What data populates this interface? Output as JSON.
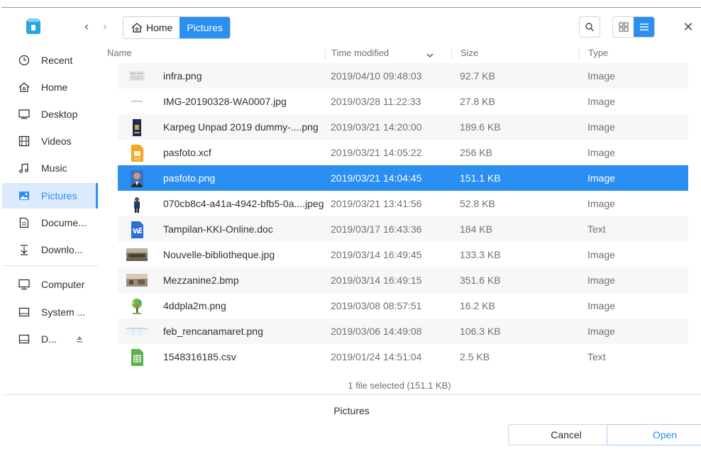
{
  "header": {
    "breadcrumb": [
      {
        "label": "Home",
        "icon": "home-icon"
      },
      {
        "label": "Pictures"
      }
    ],
    "back_icon": "chevron-left-icon",
    "forward_icon": "chevron-right-icon",
    "search_icon": "search-icon",
    "icon_view_icon": "grid-view-icon",
    "list_view_icon": "list-view-icon",
    "close_icon": "close-icon"
  },
  "sidebar": {
    "items": [
      {
        "label": "Recent",
        "icon": "clock-icon"
      },
      {
        "label": "Home",
        "icon": "home-icon"
      },
      {
        "label": "Desktop",
        "icon": "desktop-icon"
      },
      {
        "label": "Videos",
        "icon": "film-icon"
      },
      {
        "label": "Music",
        "icon": "music-icon"
      },
      {
        "label": "Pictures",
        "icon": "image-icon",
        "active": true
      },
      {
        "label": "Docume...",
        "icon": "document-icon"
      },
      {
        "label": "Downlo...",
        "icon": "download-icon"
      },
      {
        "label": "Computer",
        "icon": "computer-icon"
      },
      {
        "label": "System ...",
        "icon": "drive-icon"
      },
      {
        "label": "D...",
        "icon": "drive-icon",
        "eject_icon": "eject-icon"
      }
    ]
  },
  "list": {
    "columns": {
      "name": "Name",
      "time": "Time modified",
      "size": "Size",
      "type": "Type",
      "sort_icon": "chevron-down-icon"
    },
    "rows": [
      {
        "name": "infra.png",
        "time": "2019/04/10 09:48:03",
        "size": "92.7 KB",
        "type": "Image",
        "thumb": "image-thumbnail"
      },
      {
        "name": "IMG-20190328-WA0007.jpg",
        "time": "2019/03/28 11:22:33",
        "size": "27.8 KB",
        "type": "Image",
        "thumb": "signature-thumbnail"
      },
      {
        "name": "Karpeg Unpad 2019 dummy-....png",
        "time": "2019/03/21 14:20:00",
        "size": "189.6 KB",
        "type": "Image",
        "thumb": "card-thumbnail"
      },
      {
        "name": "pasfoto.xcf",
        "time": "2019/03/21 14:05:22",
        "size": "256 KB",
        "type": "Image",
        "thumb": "xcf-file-icon"
      },
      {
        "name": "pasfoto.png",
        "time": "2019/03/21 14:04:45",
        "size": "151.1 KB",
        "type": "Image",
        "thumb": "portrait-thumbnail",
        "selected": true
      },
      {
        "name": "070cb8c4-a41a-4942-bfb5-0a....jpeg",
        "time": "2019/03/21 13:41:56",
        "size": "52.8 KB",
        "type": "Image",
        "thumb": "person-thumbnail"
      },
      {
        "name": "Tampilan-KKI-Online.doc",
        "time": "2019/03/17 16:43:36",
        "size": "184 KB",
        "type": "Text",
        "thumb": "word-file-icon"
      },
      {
        "name": "Nouvelle-bibliotheque.jpg",
        "time": "2019/03/14 16:49:45",
        "size": "133.3 KB",
        "type": "Image",
        "thumb": "building-thumbnail"
      },
      {
        "name": "Mezzanine2.bmp",
        "time": "2019/03/14 16:49:15",
        "size": "351.6 KB",
        "type": "Image",
        "thumb": "interior-thumbnail"
      },
      {
        "name": "4ddpla2m.png",
        "time": "2019/03/08 08:57:51",
        "size": "16.2 KB",
        "type": "Image",
        "thumb": "tree-thumbnail"
      },
      {
        "name": "feb_rencanamaret.png",
        "time": "2019/03/06 14:49:08",
        "size": "106.3 KB",
        "type": "Image",
        "thumb": "table-thumbnail"
      },
      {
        "name": "1548316185.csv",
        "time": "2019/01/24 14:51:04",
        "size": "2.5 KB",
        "type": "Text",
        "thumb": "spreadsheet-file-icon"
      }
    ]
  },
  "status": "1 file selected (151.1 KB)",
  "footer": {
    "label": "Pictures",
    "cancel_label": "Cancel",
    "open_label": "Open"
  },
  "colors": {
    "accent": "#2b8ef1",
    "selected_sidebar_bg": "#dbeafc",
    "alt_row_bg": "#f7f7f7"
  }
}
